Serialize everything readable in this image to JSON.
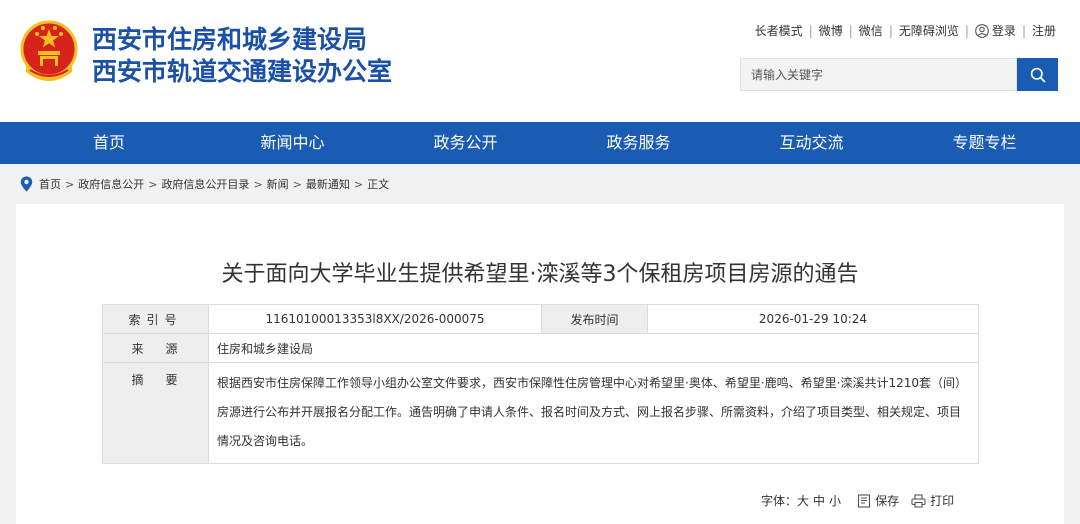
{
  "header": {
    "org_line1": "西安市住房和城乡建设局",
    "org_line2": "西安市轨道交通建设办公室",
    "emblem_icon": "national-emblem-icon"
  },
  "toplinks": {
    "elder": "长者模式",
    "weibo": "微博",
    "wechat": "微信",
    "accessible": "无障碍浏览",
    "login": "登录",
    "register": "注册",
    "sep": "|"
  },
  "search": {
    "placeholder": "请输入关键字",
    "icon": "search-icon"
  },
  "nav": {
    "items": [
      "首页",
      "新闻中心",
      "政务公开",
      "政务服务",
      "互动交流",
      "专题专栏"
    ]
  },
  "breadcrumb": {
    "items": [
      "首页",
      "政府信息公开",
      "政府信息公开目录",
      "新闻",
      "最新通知",
      "正文"
    ],
    "arrow": ">"
  },
  "article": {
    "title": "关于面向大学毕业生提供希望里·滦溪等3个保租房项目房源的通告",
    "index_label": "索引号",
    "index_value": "11610100013353l8XX/2026-000075",
    "pub_label": "发布时间",
    "pub_value": "2026-01-29 10:24",
    "source_label": "来源",
    "source_value": "住房和城乡建设局",
    "summary_label": "摘要",
    "summary_value": "根据西安市住房保障工作领导小组办公室文件要求，西安市保障性住房管理中心对希望里·奥体、希望里·鹿鸣、希望里·滦溪共计1210套（间）房源进行公布并开展报名分配工作。通告明确了申请人条件、报名时间及方式、网上报名步骤、所需资料，介绍了项目类型、相关规定、项目情况及咨询电话。"
  },
  "tools": {
    "font_label": "字体：",
    "large": "大",
    "medium": "中",
    "small": "小",
    "save": "保存",
    "print": "打印"
  },
  "colors": {
    "brand_blue": "#1a5bb3",
    "title_blue": "#1a50a8",
    "emblem_red": "#d7231c",
    "emblem_gold": "#f2c020"
  }
}
